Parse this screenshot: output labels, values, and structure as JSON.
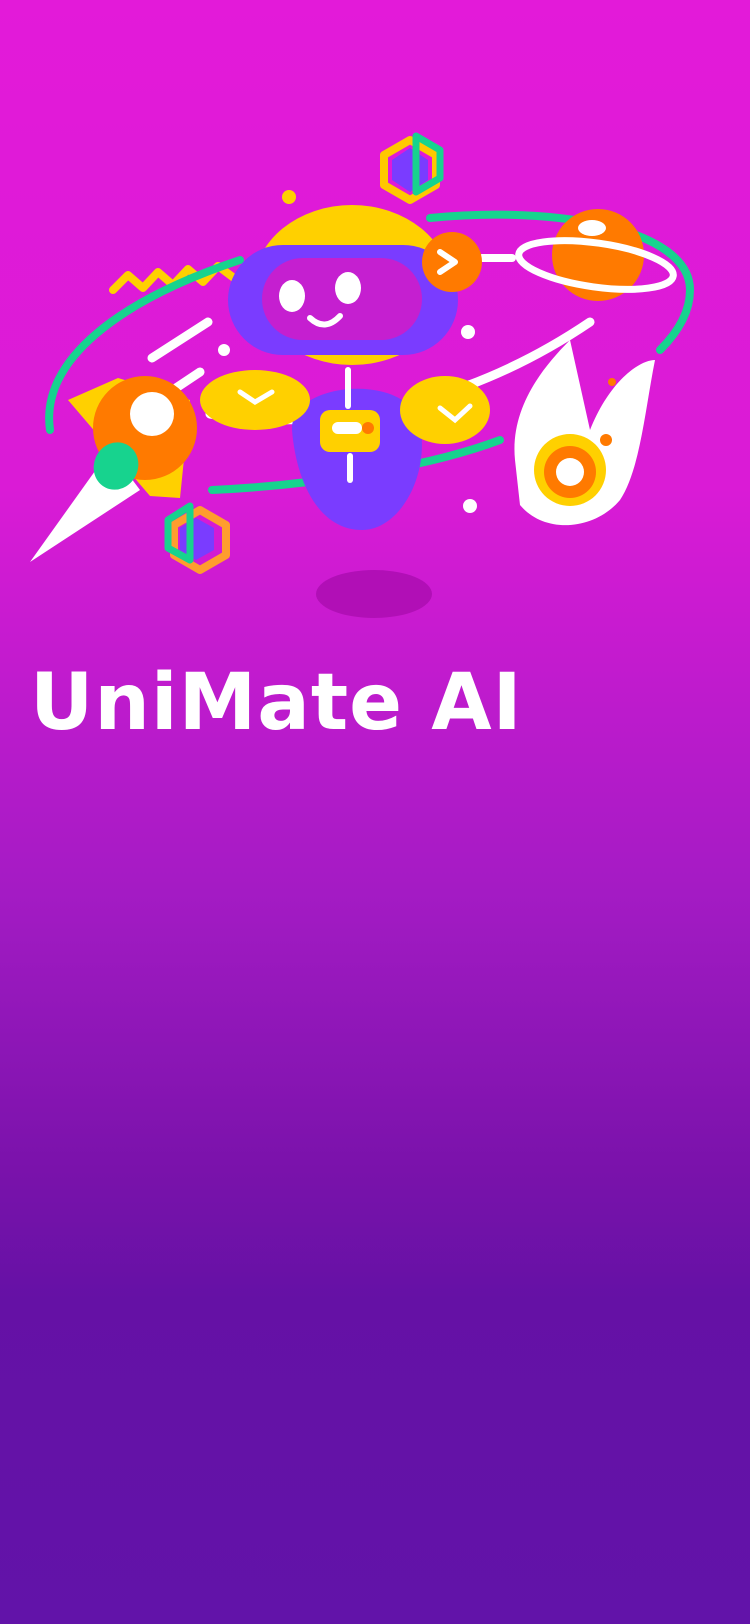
{
  "app": {
    "title": "UniMate AI"
  },
  "hero": {
    "illustration": "robot-astronaut-in-space-illustration"
  },
  "theme": {
    "background_top": "#e31ad9",
    "background_bottom": "#6213a9",
    "title_color": "#ffffff",
    "accent_yellow": "#ffd000",
    "accent_orange": "#ff7a00",
    "accent_green": "#17d38e",
    "accent_violet": "#7a3cff"
  }
}
